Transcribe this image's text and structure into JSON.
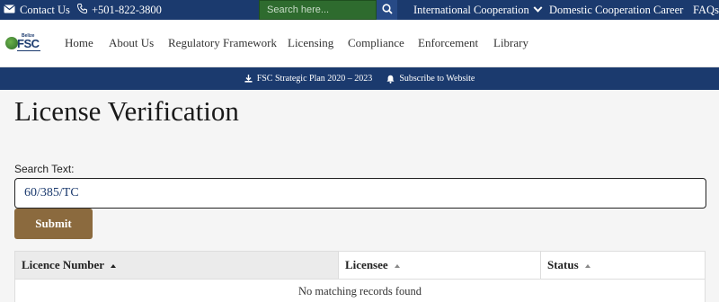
{
  "topbar": {
    "contact_label": "Contact Us",
    "phone": "+501-822-3800",
    "search_placeholder": "Search here...",
    "international": "International Cooperation",
    "domestic": "Domestic Cooperation",
    "career": "Career",
    "faqs": "FAQs"
  },
  "logo": {
    "small_text": "Belize",
    "abbr": "FSC"
  },
  "nav": {
    "items": [
      "Home",
      "About Us",
      "Regulatory Framework",
      "Licensing",
      "Compliance",
      "Enforcement",
      "Library"
    ]
  },
  "bluebar": {
    "plan": "FSC Strategic Plan 2020 – 2023",
    "subscribe": "Subscribe to Website"
  },
  "page": {
    "title": "License Verification",
    "search_label": "Search Text:",
    "search_value": "60/385/TC",
    "submit_label": "Submit"
  },
  "table": {
    "headers": [
      "Licence Number",
      "Licensee",
      "Status"
    ],
    "empty_message": "No matching records found"
  },
  "colors": {
    "navy": "#1b3a6e",
    "search_green": "#2e6b2e",
    "submit_brown": "#8b6a3e"
  },
  "icons": [
    "envelope-icon",
    "phone-icon",
    "search-icon",
    "chevron-down-icon",
    "download-icon",
    "bell-icon",
    "sort-asc-icon"
  ]
}
